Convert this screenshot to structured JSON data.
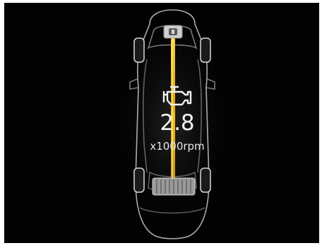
{
  "display": {
    "rpm_value": "2.8",
    "rpm_unit": "x1000rpm"
  },
  "icons": {
    "engine": "engine-icon"
  },
  "colors": {
    "background": "#020202",
    "car_outline": "#bdbdbd",
    "drive_shaft": "#f2c21a",
    "text": "#f2f2f2"
  }
}
